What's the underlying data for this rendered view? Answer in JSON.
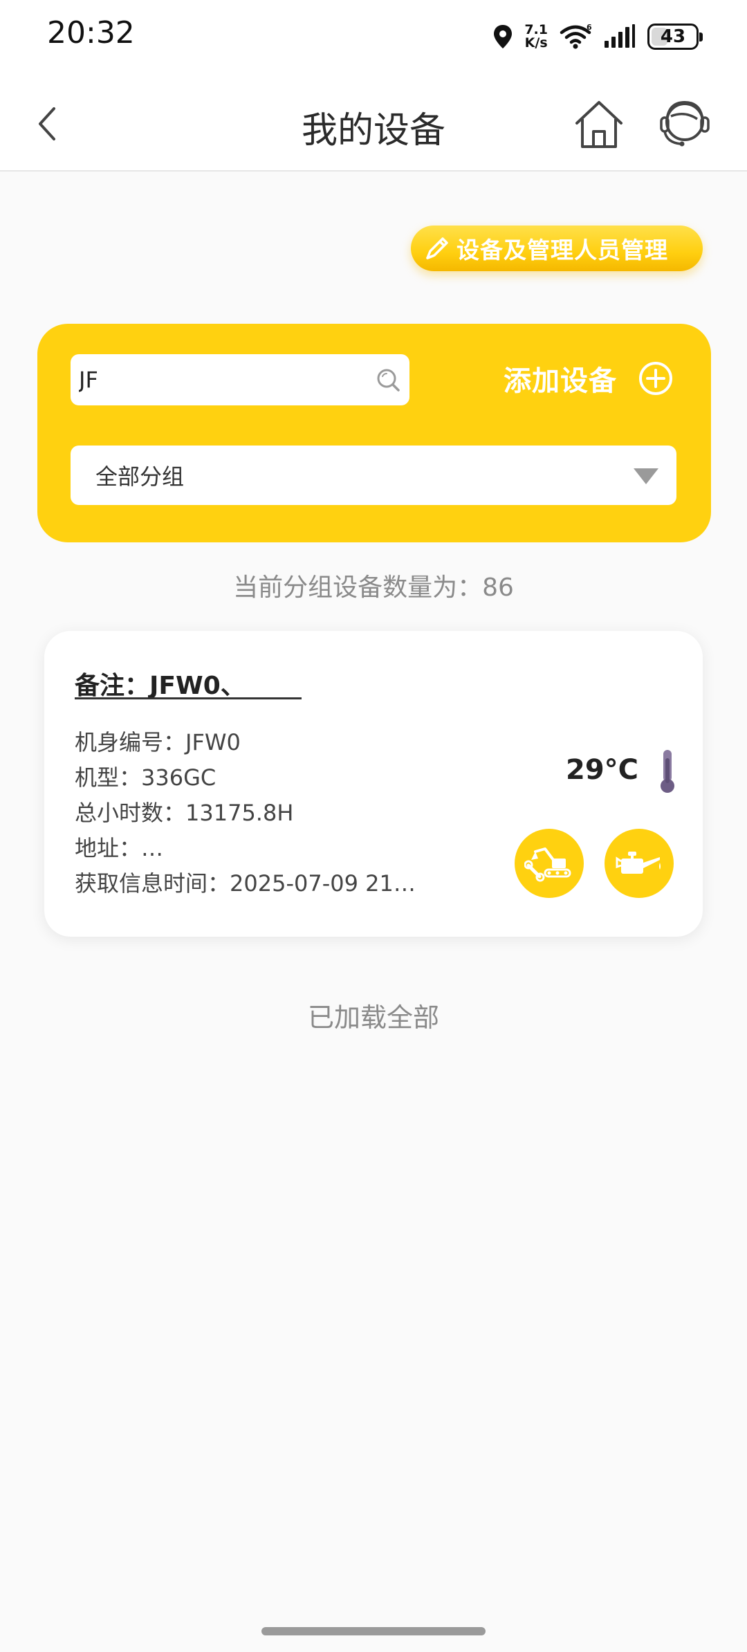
{
  "status_bar": {
    "time": "20:32",
    "net_speed_value": "7.1",
    "net_speed_unit": "K/s",
    "battery": "43",
    "battery_level": 0.43,
    "icons": [
      "location-icon",
      "wifi-icon",
      "signal-icon",
      "battery-icon"
    ]
  },
  "nav": {
    "title": "我的设备",
    "icons": [
      "back-arrow-icon",
      "home-icon",
      "customer-service-icon"
    ]
  },
  "manage": {
    "label": "设备及管理人员管理",
    "icon": "pencil-icon"
  },
  "filter": {
    "search_value": "JF",
    "search_icon": "search-icon",
    "add_label": "添加设备",
    "add_icon": "plus-circle-icon",
    "group_selected": "全部分组",
    "group_icon": "chevron-down-icon"
  },
  "device_count_text": "当前分组设备数量为：86",
  "device": {
    "remark": "备注：JFW0、",
    "serial": "机身编号：JFW0",
    "model": "机型：336GC",
    "hours": "总小时数：13175.8H",
    "address": "地址：…",
    "fetch_time": "获取信息时间：2025-07-09 21…",
    "temperature": "29°C",
    "icons": [
      "thermometer-icon",
      "excavator-repair-icon",
      "oil-can-icon"
    ]
  },
  "loaded_all_text": "已加载全部",
  "colors": {
    "accent": "#ffd110",
    "pill_gradient_top": "#ffe04a",
    "pill_gradient_bottom": "#f5b800",
    "thermometer": "#7a6a8c",
    "text_gray": "#8a8a8a"
  }
}
